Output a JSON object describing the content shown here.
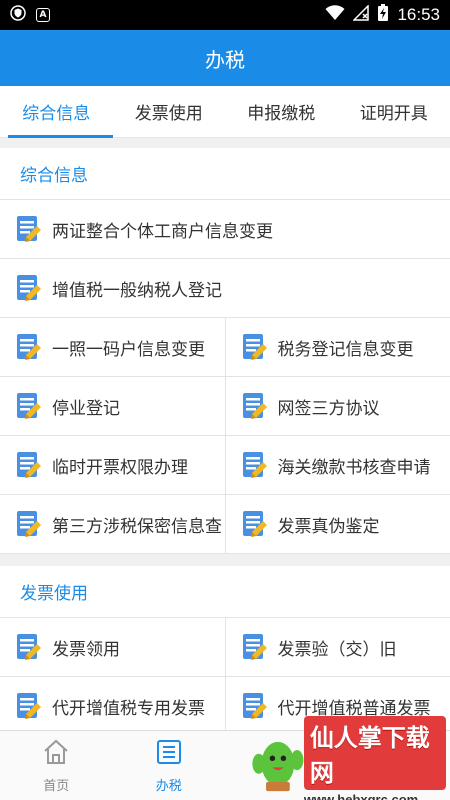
{
  "status_bar": {
    "time": "16:53",
    "icons": [
      "shield-icon",
      "a-icon",
      "wifi-icon",
      "no-sim-icon",
      "battery-charging-icon"
    ]
  },
  "app_bar": {
    "title": "办税"
  },
  "tabs": [
    {
      "label": "综合信息",
      "active": true
    },
    {
      "label": "发票使用",
      "active": false
    },
    {
      "label": "申报缴税",
      "active": false
    },
    {
      "label": "证明开具",
      "active": false
    }
  ],
  "sections": [
    {
      "title": "综合信息",
      "rows": [
        [
          "两证整合个体工商户信息变更"
        ],
        [
          "增值税一般纳税人登记"
        ],
        [
          "一照一码户信息变更",
          "税务登记信息变更"
        ],
        [
          "停业登记",
          "网签三方协议"
        ],
        [
          "临时开票权限办理",
          "海关缴款书核查申请"
        ],
        [
          "第三方涉税保密信息查",
          "发票真伪鉴定"
        ]
      ]
    },
    {
      "title": "发票使用",
      "rows": [
        [
          "发票领用",
          "发票验（交）旧"
        ],
        [
          "代开增值税专用发票",
          "代开增值税普通发票"
        ]
      ]
    }
  ],
  "bottom_nav": [
    {
      "label": "首页",
      "icon": "home-icon",
      "active": false
    },
    {
      "label": "办税",
      "icon": "list-icon",
      "active": true
    },
    {
      "label": "",
      "icon": "download-icon",
      "active": false
    },
    {
      "label": "",
      "icon": "user-icon",
      "active": false
    }
  ],
  "watermark": {
    "main": "仙人掌下载网",
    "url": "www.hebxqrc.com"
  },
  "colors": {
    "primary": "#1a8ce8",
    "icon_blue": "#4a90e2",
    "icon_yellow": "#f2b824"
  }
}
